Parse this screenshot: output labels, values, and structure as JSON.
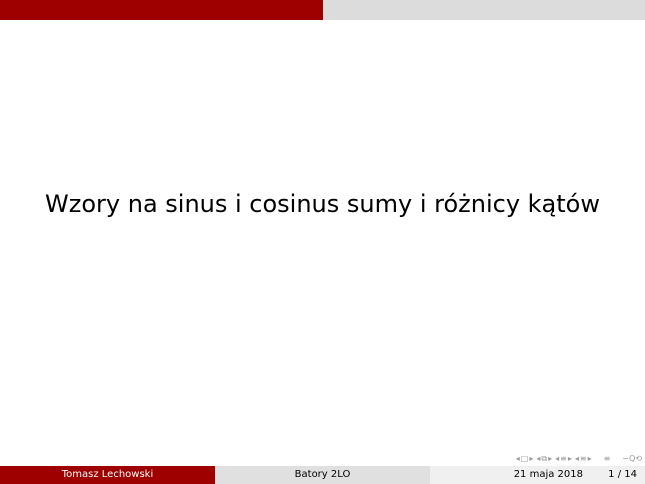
{
  "theme": {
    "accent": "#9e0000",
    "progress_track": "#dcdcdc",
    "footer_mid": "#e0e0e0",
    "footer_right": "#f0f0f0",
    "footer_author_text": "#ffffff",
    "footer_text": "#000000"
  },
  "slide": {
    "title": "Wzory na sinus i cosinus sumy i różnicy kątów"
  },
  "progress": {
    "fraction": 0.5
  },
  "navigation": {
    "icons": [
      "arrow-left-icon",
      "frame-icon",
      "arrow-right-icon",
      "arrow-left-icon",
      "subsection-icon",
      "arrow-right-icon",
      "arrow-left-icon",
      "section-icon",
      "arrow-right-icon",
      "arrow-left-icon",
      "subsubsection-icon",
      "arrow-right-icon",
      "align-icon",
      "zoom-icon"
    ]
  },
  "footer": {
    "author": "Tomasz Lechowski",
    "institute": "Batory 2LO",
    "date": "21 maja 2018",
    "page": "1 / 14"
  }
}
